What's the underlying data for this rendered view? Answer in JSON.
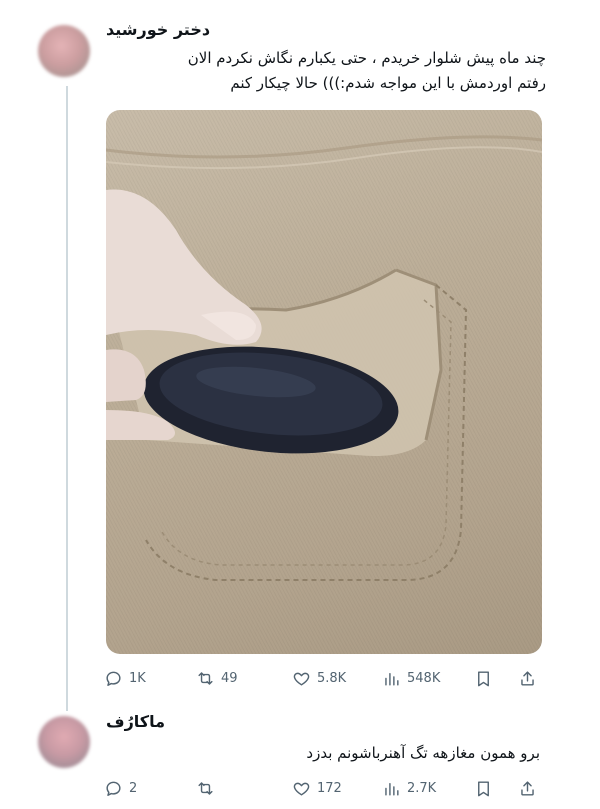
{
  "post": {
    "author": "دختر خورشید",
    "text_line1": "چند ماه پیش شلوار خریدم ، حتی یکبارم نگاش نکردم الان",
    "text_line2": "رفتم اوردمش با این مواجه شدم:))) حالا چیکار کنم",
    "image_description": "",
    "stats": {
      "replies": "1K",
      "reposts": "49",
      "likes": "5.8K",
      "views": "548K"
    }
  },
  "reply": {
    "author": "ماکارُف",
    "text": "برو همون مغازهه تگ آهنرباشونم بدزد",
    "stats": {
      "replies": "2",
      "reposts": "",
      "likes": "172",
      "views": "2.7K"
    }
  },
  "colors": {
    "text": "#0f1419",
    "muted": "#536471",
    "thread_line": "#cfd9de"
  },
  "icons": [
    "reply-icon",
    "repost-icon",
    "like-icon",
    "views-icon",
    "bookmark-icon",
    "share-icon"
  ]
}
